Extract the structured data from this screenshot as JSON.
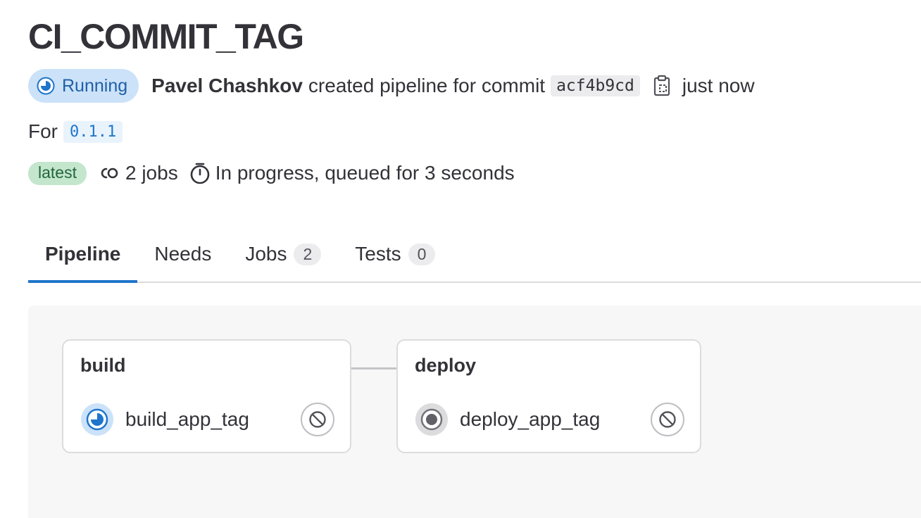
{
  "pipeline": {
    "title": "CI_COMMIT_TAG",
    "status": {
      "label": "Running",
      "icon": "status-running-icon",
      "color": "#1f75cb"
    },
    "author": "Pavel Chashkov",
    "action_text": "created pipeline for commit",
    "commit_sha": "acf4b9cd",
    "copy_icon": "copy-to-clipboard-icon",
    "time_ago": "just now",
    "ref": {
      "prefix": "For",
      "name": "0.1.1"
    },
    "badge_latest": "latest",
    "jobs_count_text": "2 jobs",
    "duration_text": "In progress, queued for 3 seconds"
  },
  "tabs": [
    {
      "label": "Pipeline",
      "active": true
    },
    {
      "label": "Needs"
    },
    {
      "label": "Jobs",
      "count": "2"
    },
    {
      "label": "Tests",
      "count": "0"
    }
  ],
  "stages": [
    {
      "name": "build",
      "jobs": [
        {
          "name": "build_app_tag",
          "status": "running",
          "action_icon": "cancel-icon"
        }
      ]
    },
    {
      "name": "deploy",
      "jobs": [
        {
          "name": "deploy_app_tag",
          "status": "created",
          "action_icon": "cancel-icon"
        }
      ]
    }
  ],
  "colors": {
    "accent": "#1f75cb",
    "running_bg": "#cbe2f9",
    "latest_bg": "#c3e6cd",
    "latest_text": "#24663b"
  }
}
